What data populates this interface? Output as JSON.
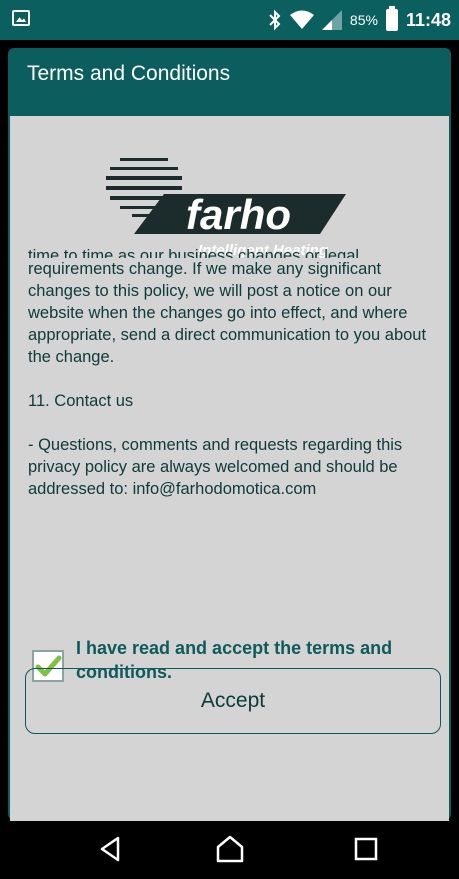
{
  "status_bar": {
    "battery_percent": "85%",
    "time": "11:48",
    "icons": [
      "image-icon",
      "bluetooth-icon",
      "wifi-icon",
      "signal-icon",
      "battery-icon"
    ]
  },
  "dialog": {
    "title": "Terms and Conditions",
    "logo": {
      "name": "farho",
      "tagline": "Intelligent Heating"
    },
    "body": {
      "clipped_line": "time to time as our business changes or legal",
      "paragraph_1": "requirements change. If we make any significant changes to this policy, we will post a notice on our website when the changes go into effect, and where appropriate, send a direct communication to you about the change.",
      "section_heading": "11. Contact us",
      "paragraph_2": "- Questions, comments and requests regarding this privacy policy are always welcomed and should be addressed to: info@farhodomotica.com"
    },
    "checkbox": {
      "label": "I have read and accept the terms and conditions.",
      "checked": true
    },
    "accept_button_label": "Accept"
  },
  "nav_bar": {
    "icons": [
      "back-icon",
      "home-icon",
      "recents-icon"
    ]
  },
  "colors": {
    "header": "#0c5e5e",
    "body_bg": "#d3d4d3",
    "text": "#0d3a3a",
    "accent": "#0f5a5a",
    "check": "#7fc142"
  }
}
